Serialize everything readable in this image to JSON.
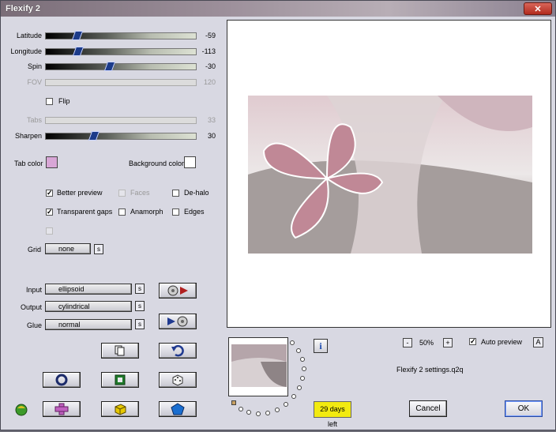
{
  "window": {
    "title": "Flexify 2",
    "close_glyph": "✕"
  },
  "sliders": {
    "latitude": {
      "label": "Latitude",
      "value": "-59",
      "fraction": 0.19
    },
    "longitude": {
      "label": "Longitude",
      "value": "-113",
      "fraction": 0.2
    },
    "spin": {
      "label": "Spin",
      "value": "-30",
      "fraction": 0.42
    },
    "fov": {
      "label": "FOV",
      "value": "120"
    },
    "tabs": {
      "label": "Tabs",
      "value": "33"
    },
    "sharpen": {
      "label": "Sharpen",
      "value": "30",
      "fraction": 0.31
    }
  },
  "flip": {
    "label": "Flip"
  },
  "colors": {
    "tab_label": "Tab color",
    "tab_color": "#d8a6d6",
    "bg_label": "Background color",
    "bg_color": "#ffffff"
  },
  "options": {
    "better_preview": "Better preview",
    "faces": "Faces",
    "de_halo": "De-halo",
    "transparent_gaps": "Transparent gaps",
    "anamorph": "Anamorph",
    "edges": "Edges",
    "check_glyph": "✓"
  },
  "grid": {
    "label": "Grid",
    "value": "none"
  },
  "projection": {
    "input_label": "Input",
    "input_value": "ellipsoid",
    "output_label": "Output",
    "output_value": "cylindrical",
    "glue_label": "Glue",
    "glue_value": "normal",
    "s_glyph": "s"
  },
  "info_glyph": "i",
  "zoom": {
    "minus": "-",
    "value": "50%",
    "plus": "+"
  },
  "auto_preview": {
    "label": "Auto preview",
    "a_glyph": "A"
  },
  "settings_file": "Flexify 2 settings.q2q",
  "trial": "29 days left",
  "buttons": {
    "cancel": "Cancel",
    "ok": "OK"
  }
}
